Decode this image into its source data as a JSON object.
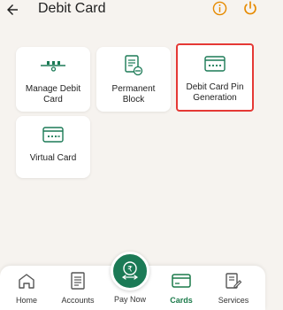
{
  "header": {
    "title": "Debit Card",
    "accent_color": "#e68a00"
  },
  "cards": [
    {
      "label": "Manage Debit Card",
      "icon": "slider-icon"
    },
    {
      "label": "Permanent Block",
      "icon": "document-block-icon"
    },
    {
      "label": "Debit Card Pin Generation",
      "icon": "card-pin-icon",
      "highlighted": true
    },
    {
      "label": "Virtual Card",
      "icon": "virtual-card-icon"
    }
  ],
  "bottom_nav": {
    "home": "Home",
    "accounts": "Accounts",
    "pay_now": "Pay Now",
    "cards": "Cards",
    "services": "Services",
    "active": "Cards",
    "active_color": "#1b7a4a"
  }
}
